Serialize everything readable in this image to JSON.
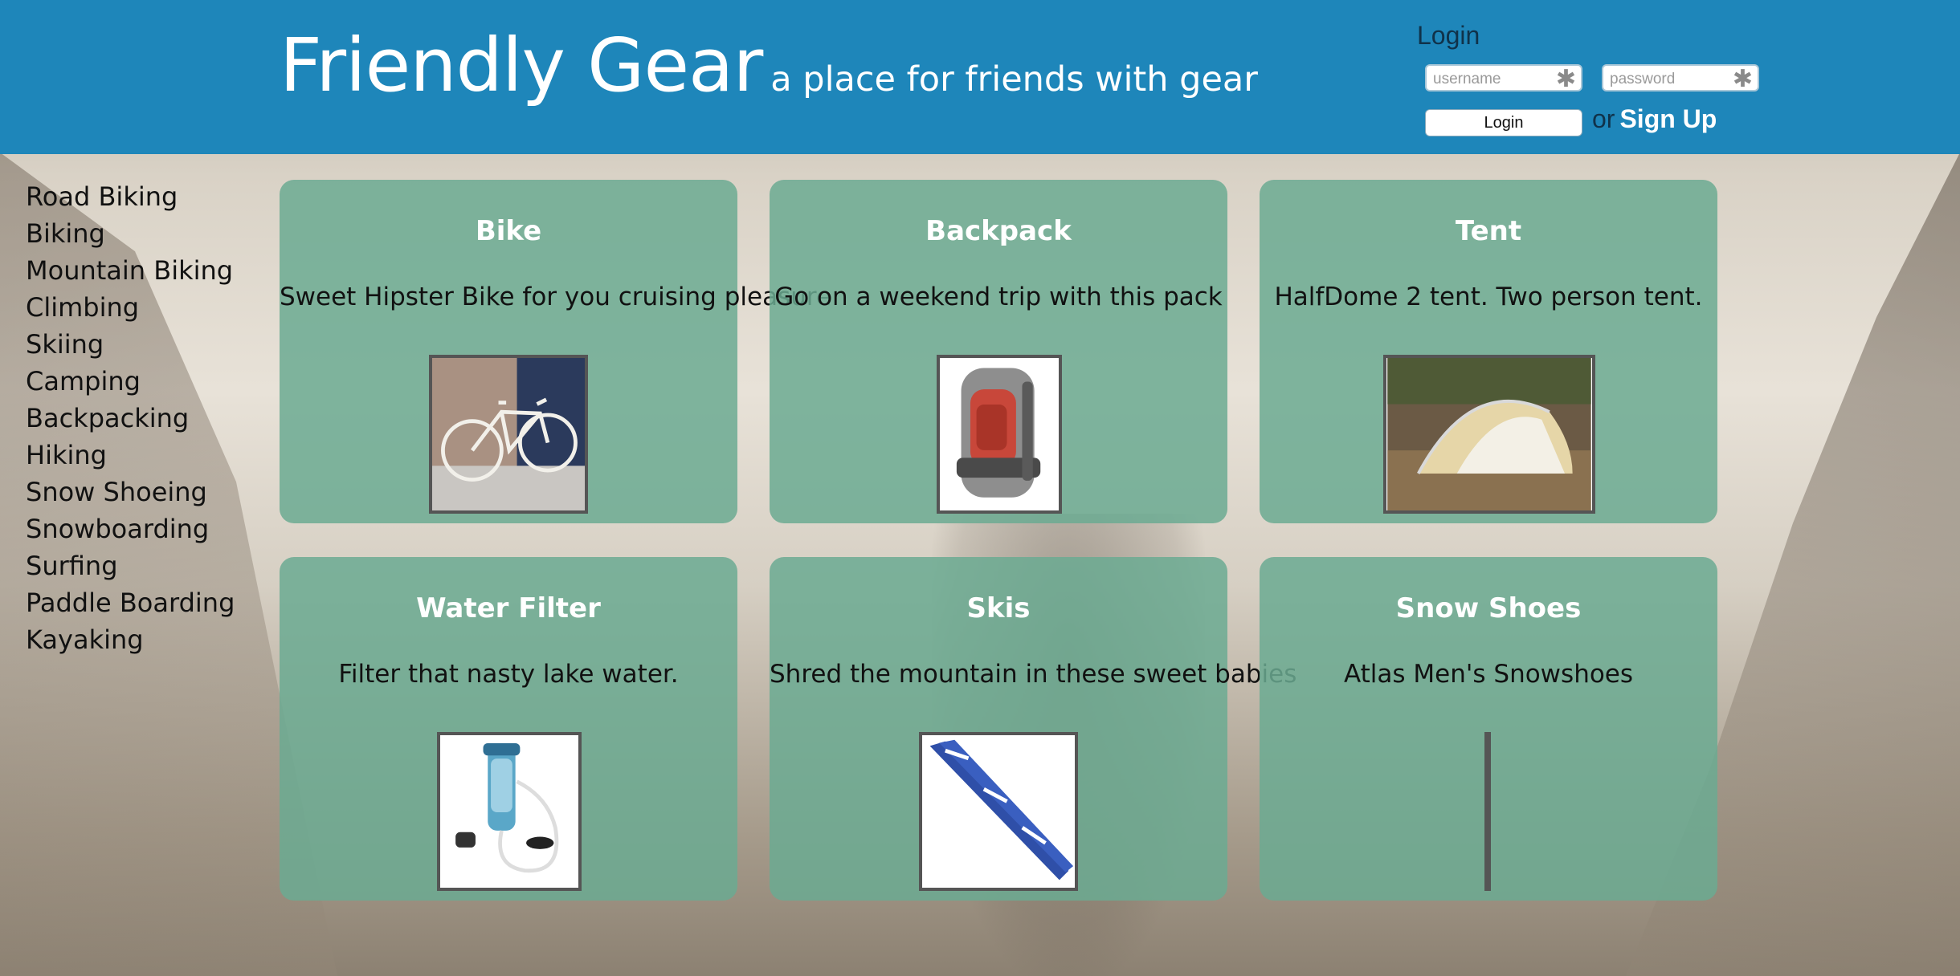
{
  "header": {
    "title": "Friendly Gear",
    "tagline": "a place for friends with gear",
    "background_color": "#1e86ba"
  },
  "login": {
    "heading": "Login",
    "username_placeholder": "username",
    "password_placeholder": "password",
    "button_label": "Login",
    "or_text": "or",
    "signup_label": "Sign Up"
  },
  "sidebar": {
    "items": [
      {
        "label": "Road Biking"
      },
      {
        "label": "Biking"
      },
      {
        "label": "Mountain Biking"
      },
      {
        "label": "Climbing"
      },
      {
        "label": "Skiing"
      },
      {
        "label": "Camping"
      },
      {
        "label": "Backpacking"
      },
      {
        "label": "Hiking"
      },
      {
        "label": "Snow Shoeing"
      },
      {
        "label": "Snowboarding"
      },
      {
        "label": "Surfing"
      },
      {
        "label": "Paddle Boarding"
      },
      {
        "label": "Kayaking"
      }
    ]
  },
  "gear": [
    {
      "title": "Bike",
      "description": "Sweet Hipster Bike for you cruising pleasure",
      "image": "bike-photo"
    },
    {
      "title": "Backpack",
      "description": "Go on a weekend trip with this pack",
      "image": "backpack-photo"
    },
    {
      "title": "Tent",
      "description": "HalfDome 2 tent. Two person tent.",
      "image": "tent-photo"
    },
    {
      "title": "Water Filter",
      "description": "Filter that nasty lake water.",
      "image": "water-filter-photo"
    },
    {
      "title": "Skis",
      "description": "Shred the mountain in these sweet babies",
      "image": "skis-photo"
    },
    {
      "title": "Snow Shoes",
      "description": "Atlas Men's Snowshoes",
      "image": "broken-image"
    }
  ],
  "colors": {
    "card_background": "#6baa92",
    "card_title": "#ffffff",
    "accent": "#1e86ba"
  }
}
